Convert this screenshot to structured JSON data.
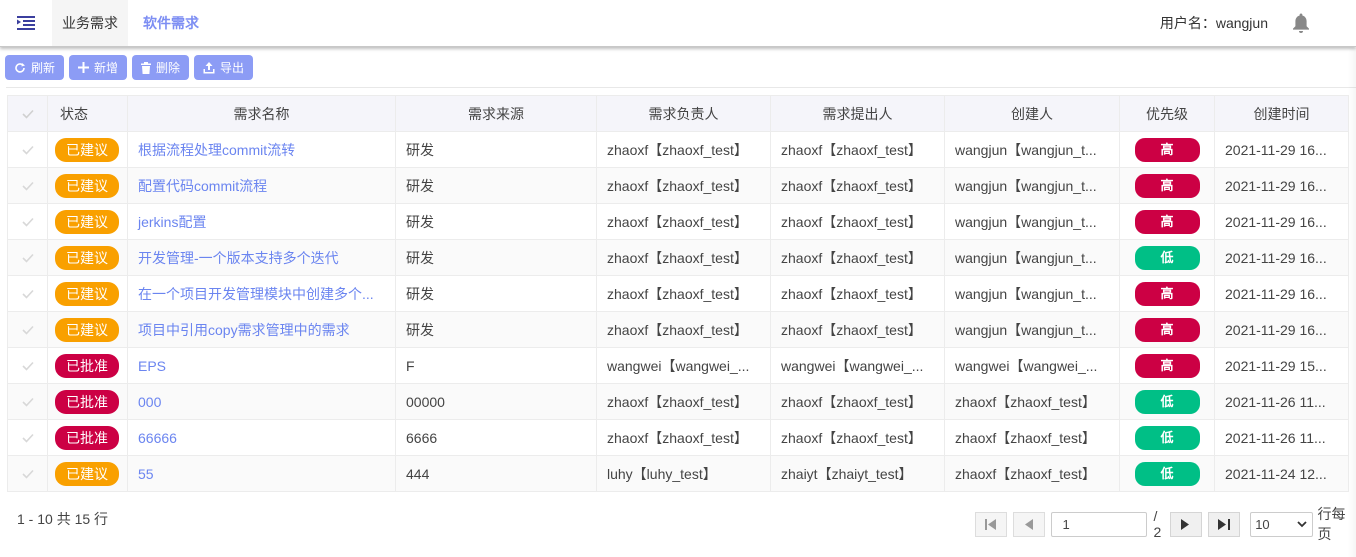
{
  "header": {
    "tabs": [
      {
        "label": "业务需求",
        "active": true
      },
      {
        "label": "软件需求",
        "active": false
      }
    ],
    "username_label": "用户名：wangjun",
    "icons": {
      "menu": "menu-indent-icon",
      "notification": "bell-icon"
    }
  },
  "toolbar": {
    "refresh_label": "刷新",
    "add_label": "新增",
    "delete_label": "删除",
    "export_label": "导出"
  },
  "colors": {
    "accent": "#8c9cf5",
    "link": "#6b85f0",
    "status_suggested": "#f9a000",
    "status_approved": "#cc0044",
    "priority_high": "#cc0044",
    "priority_low": "#00bf86"
  },
  "table": {
    "columns": [
      "",
      "状态",
      "需求名称",
      "需求来源",
      "需求负责人",
      "需求提出人",
      "创建人",
      "优先级",
      "创建时间"
    ],
    "rows": [
      {
        "status": "已建议",
        "status_type": "suggested",
        "name": "根据流程处理commit流转",
        "source": "研发",
        "owner": "zhaoxf【zhaoxf_test】",
        "proposer": "zhaoxf【zhaoxf_test】",
        "creator": "wangjun【wangjun_t...",
        "priority": "高",
        "priority_type": "high",
        "created": "2021-11-29 16..."
      },
      {
        "status": "已建议",
        "status_type": "suggested",
        "name": "配置代码commit流程",
        "source": "研发",
        "owner": "zhaoxf【zhaoxf_test】",
        "proposer": "zhaoxf【zhaoxf_test】",
        "creator": "wangjun【wangjun_t...",
        "priority": "高",
        "priority_type": "high",
        "created": "2021-11-29 16..."
      },
      {
        "status": "已建议",
        "status_type": "suggested",
        "name": "jerkins配置",
        "source": "研发",
        "owner": "zhaoxf【zhaoxf_test】",
        "proposer": "zhaoxf【zhaoxf_test】",
        "creator": "wangjun【wangjun_t...",
        "priority": "高",
        "priority_type": "high",
        "created": "2021-11-29 16..."
      },
      {
        "status": "已建议",
        "status_type": "suggested",
        "name": "开发管理-一个版本支持多个迭代",
        "source": "研发",
        "owner": "zhaoxf【zhaoxf_test】",
        "proposer": "zhaoxf【zhaoxf_test】",
        "creator": "wangjun【wangjun_t...",
        "priority": "低",
        "priority_type": "low",
        "created": "2021-11-29 16..."
      },
      {
        "status": "已建议",
        "status_type": "suggested",
        "name": "在一个项目开发管理模块中创建多个...",
        "source": "研发",
        "owner": "zhaoxf【zhaoxf_test】",
        "proposer": "zhaoxf【zhaoxf_test】",
        "creator": "wangjun【wangjun_t...",
        "priority": "高",
        "priority_type": "high",
        "created": "2021-11-29 16..."
      },
      {
        "status": "已建议",
        "status_type": "suggested",
        "name": "项目中引用copy需求管理中的需求",
        "source": "研发",
        "owner": "zhaoxf【zhaoxf_test】",
        "proposer": "zhaoxf【zhaoxf_test】",
        "creator": "wangjun【wangjun_t...",
        "priority": "高",
        "priority_type": "high",
        "created": "2021-11-29 16..."
      },
      {
        "status": "已批准",
        "status_type": "approved",
        "name": "EPS",
        "source": "F",
        "owner": "wangwei【wangwei_...",
        "proposer": "wangwei【wangwei_...",
        "creator": "wangwei【wangwei_...",
        "priority": "高",
        "priority_type": "high",
        "created": "2021-11-29 15..."
      },
      {
        "status": "已批准",
        "status_type": "approved",
        "name": "000",
        "source": "00000",
        "owner": "zhaoxf【zhaoxf_test】",
        "proposer": "zhaoxf【zhaoxf_test】",
        "creator": "zhaoxf【zhaoxf_test】",
        "priority": "低",
        "priority_type": "low",
        "created": "2021-11-26 11..."
      },
      {
        "status": "已批准",
        "status_type": "approved",
        "name": "66666",
        "source": "6666",
        "owner": "zhaoxf【zhaoxf_test】",
        "proposer": "zhaoxf【zhaoxf_test】",
        "creator": "zhaoxf【zhaoxf_test】",
        "priority": "低",
        "priority_type": "low",
        "created": "2021-11-26 11..."
      },
      {
        "status": "已建议",
        "status_type": "suggested",
        "name": "55",
        "source": "444",
        "owner": "luhy【luhy_test】",
        "proposer": "zhaiyt【zhaiyt_test】",
        "creator": "zhaoxf【zhaoxf_test】",
        "priority": "低",
        "priority_type": "low",
        "created": "2021-11-24 12..."
      }
    ]
  },
  "footer": {
    "range_text": "1 - 10 共 15 行",
    "page_value": "1",
    "total_pages": "/ 2",
    "page_size": "10",
    "per_page_label": "行每页"
  }
}
